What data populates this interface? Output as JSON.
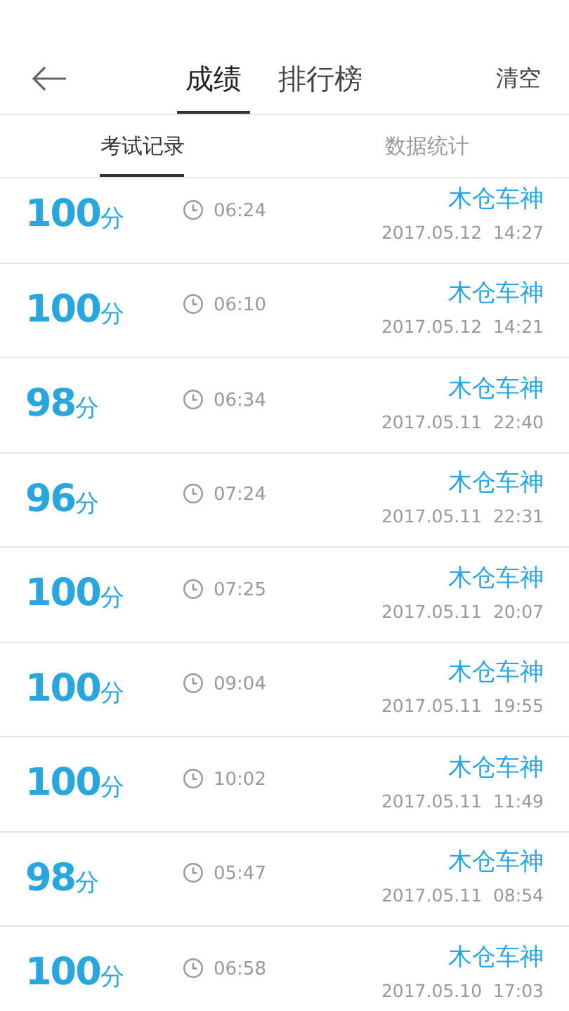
{
  "header": {
    "tabs": [
      {
        "label": "成绩",
        "selected": true
      },
      {
        "label": "排行榜",
        "selected": false
      }
    ],
    "action": "清空"
  },
  "subtabs": [
    {
      "label": "考试记录",
      "selected": true
    },
    {
      "label": "数据统计",
      "selected": false
    }
  ],
  "records": [
    {
      "score": "100",
      "unit": "分",
      "duration": "06:24",
      "name": "木仓车神",
      "datetime": "2017.05.12  14:27"
    },
    {
      "score": "100",
      "unit": "分",
      "duration": "06:10",
      "name": "木仓车神",
      "datetime": "2017.05.12  14:21"
    },
    {
      "score": "98",
      "unit": "分",
      "duration": "06:34",
      "name": "木仓车神",
      "datetime": "2017.05.11  22:40"
    },
    {
      "score": "96",
      "unit": "分",
      "duration": "07:24",
      "name": "木仓车神",
      "datetime": "2017.05.11  22:31"
    },
    {
      "score": "100",
      "unit": "分",
      "duration": "07:25",
      "name": "木仓车神",
      "datetime": "2017.05.11  20:07"
    },
    {
      "score": "100",
      "unit": "分",
      "duration": "09:04",
      "name": "木仓车神",
      "datetime": "2017.05.11  19:55"
    },
    {
      "score": "100",
      "unit": "分",
      "duration": "10:02",
      "name": "木仓车神",
      "datetime": "2017.05.11  11:49"
    },
    {
      "score": "98",
      "unit": "分",
      "duration": "05:47",
      "name": "木仓车神",
      "datetime": "2017.05.11  08:54"
    },
    {
      "score": "100",
      "unit": "分",
      "duration": "06:58",
      "name": "木仓车神",
      "datetime": "2017.05.10  17:03"
    }
  ]
}
